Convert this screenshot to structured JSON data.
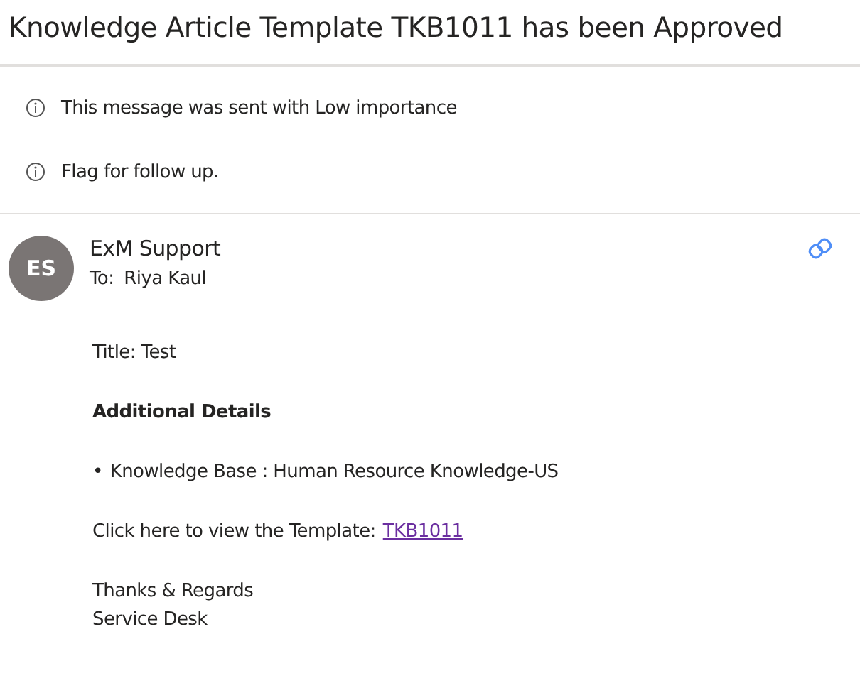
{
  "subject": "Knowledge Article Template TKB1011 has been Approved",
  "notices": [
    "This message was sent with Low importance",
    "Flag for follow up."
  ],
  "sender": {
    "initials": "ES",
    "name": "ExM Support",
    "to_label": "To:",
    "to": "Riya Kaul"
  },
  "body": [
    {
      "kind": "text",
      "text": "Title: Test"
    },
    {
      "kind": "heading",
      "text": "Additional Details"
    },
    {
      "kind": "bullet",
      "bullet": "•",
      "text": "Knowledge Base : Human Resource Knowledge-US"
    },
    {
      "kind": "link",
      "text": "Click here to view the Template:",
      "link": "TKB1011"
    },
    {
      "kind": "lines",
      "lines": [
        "Thanks & Regards",
        "Service Desk"
      ]
    }
  ]
}
